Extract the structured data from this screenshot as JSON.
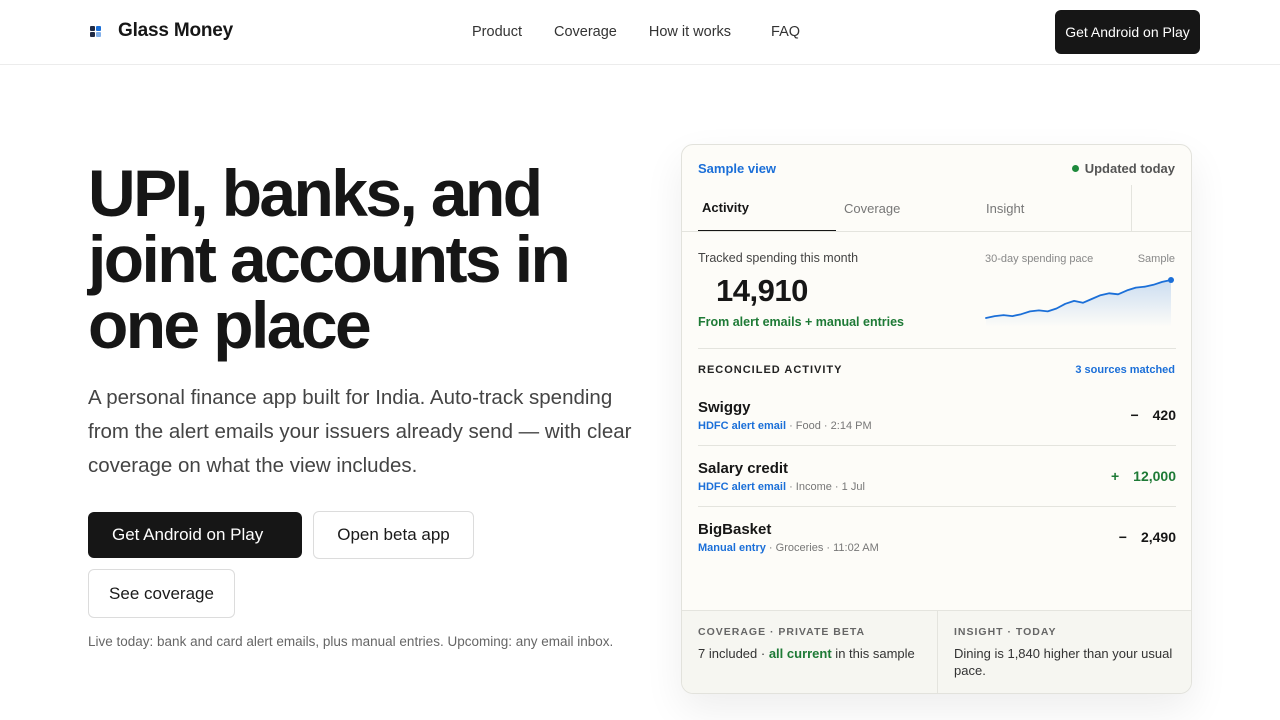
{
  "header": {
    "brand": "Glass Money",
    "nav": [
      "Product",
      "Coverage",
      "How it works",
      "FAQ"
    ],
    "cta": "Get Android on Play"
  },
  "hero": {
    "title": "UPI, banks, and joint accounts in one place",
    "subtitle": "A personal finance app built for India. Auto-track spending from the alert emails your issuers already send — with clear coverage on what the view includes.",
    "primary_button": "Get Android on Play",
    "beta_button": "Open beta app",
    "coverage_button": "See coverage",
    "live_note": "Live today:  bank and card alert emails, plus manual entries. Upcoming: any email inbox."
  },
  "card": {
    "label": "Sample view",
    "updated": "Updated today",
    "tabs": [
      "Activity",
      "Coverage",
      "Insight"
    ],
    "spend_label": "Tracked spending this month",
    "spend_value": "14,910",
    "spend_source": "From alert emails + manual entries",
    "pace_label": "30-day spending pace",
    "pace_sample": "Sample",
    "pace_series": [
      2,
      4,
      5,
      4,
      6,
      9,
      10,
      9,
      12,
      17,
      20,
      18,
      22,
      26,
      28,
      27,
      31,
      34,
      35,
      37,
      40,
      42
    ],
    "reconciled_title": "RECONCILED ACTIVITY",
    "reconciled_match": "3 sources matched",
    "transactions": [
      {
        "name": "Swiggy",
        "source": "HDFC alert email",
        "meta": " · Food · 2:14 PM",
        "sign": "−",
        "amount": "420"
      },
      {
        "name": "Salary credit",
        "source": "HDFC alert email",
        "meta": " · Income · 1 Jul",
        "sign": "+",
        "amount": "12,000"
      },
      {
        "name": "BigBasket",
        "source": "Manual entry",
        "meta": " · Groceries · 11:02 AM",
        "sign": "−",
        "amount": "2,490"
      }
    ],
    "coverage_heading": "COVERAGE · PRIVATE BETA",
    "coverage_pre": "7 included · ",
    "coverage_highlight": "all current",
    "coverage_post": " in this sample",
    "insight_heading": "INSIGHT · TODAY",
    "insight_text": "Dining is   1,840 higher than your usual pace."
  },
  "colors": {
    "accent": "#1b6fd8",
    "positive": "#1e7a36",
    "dark": "#161616"
  }
}
